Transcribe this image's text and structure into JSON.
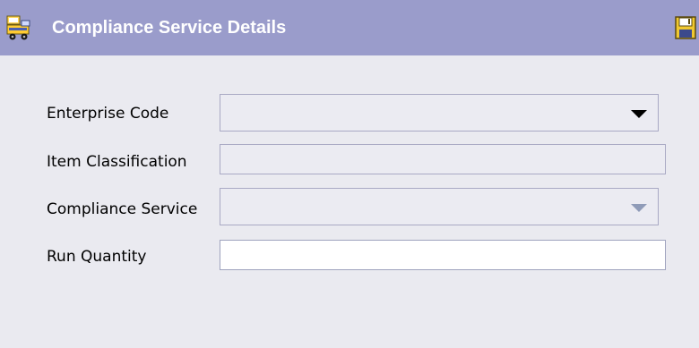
{
  "header": {
    "title": "Compliance Service Details",
    "icon": "truck-icon",
    "save_icon": "floppy-disk-icon",
    "background": "#9a9ccb"
  },
  "form": {
    "enterprise_code": {
      "label": "Enterprise Code",
      "value": "",
      "type": "select",
      "enabled": true
    },
    "item_classification": {
      "label": "Item Classification",
      "value": "",
      "type": "text",
      "enabled": false
    },
    "compliance_service": {
      "label": "Compliance Service",
      "value": "",
      "type": "select",
      "enabled": false
    },
    "run_quantity": {
      "label": "Run Quantity",
      "value": "",
      "type": "text",
      "enabled": true
    }
  }
}
